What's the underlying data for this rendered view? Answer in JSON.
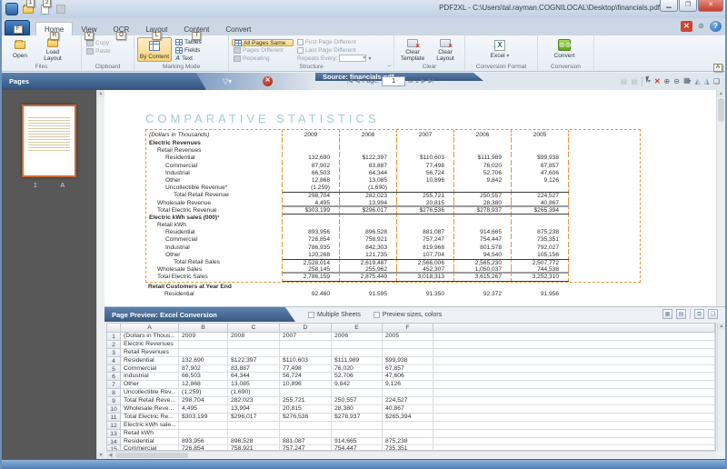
{
  "titlebar": {
    "title": "PDF2XL - C:\\Users\\tal.rayman.COGNILOCAL\\Desktop\\financials.pdf"
  },
  "qat": {
    "keytip_open": "1",
    "keytip_load": "2"
  },
  "file_button": {
    "keytip": "F"
  },
  "tabs": [
    {
      "label": "Home",
      "keytip": "H"
    },
    {
      "label": "View",
      "keytip": "V"
    },
    {
      "label": "OCR",
      "keytip": "O"
    },
    {
      "label": "Layout",
      "keytip": "L"
    },
    {
      "label": "Content",
      "keytip": "T"
    },
    {
      "label": "Convert",
      "keytip": ""
    }
  ],
  "ribbon": {
    "keytip_right": "A",
    "files": {
      "open": "Open",
      "load_layout": "Load Layout",
      "group": "Files"
    },
    "clipboard": {
      "copy": "Copy",
      "paste": "Paste",
      "group": "Clipboard"
    },
    "marking_mode": {
      "by_content": "By Content",
      "tables": "Tables",
      "fields": "Fields",
      "text": "Text",
      "group": "Marking Mode"
    },
    "structure": {
      "all_pages_same": "All Pages Same",
      "pages_different": "Pages Different",
      "repeating": "Repeating",
      "first_page_different": "First Page Different",
      "last_page_different": "Last Page Different",
      "repeats_every": "Repeats Every:",
      "group": "Structure"
    },
    "clear": {
      "clear_template": "Clear Template",
      "clear_layout": "Clear Layout",
      "group": "Clear"
    },
    "conversion_format": {
      "excel": "Excel",
      "group": "Conversion Format"
    },
    "conversion": {
      "convert": "Convert",
      "group": "Conversion"
    }
  },
  "doc_toolbar": {
    "page_label": "Page:",
    "page_value": "1",
    "of_label": "of 1"
  },
  "pages_panel": {
    "title": "Pages",
    "thumb_number": "1",
    "thumb_letter": "A"
  },
  "source_tab": {
    "label": "Source: financials.pdf"
  },
  "document": {
    "title": "COMPARATIVE STATISTICS",
    "table": {
      "caption": "(Dollars in Thousands)",
      "years": [
        "2009",
        "2008",
        "2007",
        "2006",
        "2005"
      ],
      "rows": [
        {
          "label": "Electric Revenues",
          "indent": 0,
          "bold": true,
          "values": [
            "",
            "",
            "",
            "",
            ""
          ]
        },
        {
          "label": "Retail Revenues",
          "indent": 1,
          "values": [
            "",
            "",
            "",
            "",
            ""
          ]
        },
        {
          "label": "Residential",
          "indent": 2,
          "values": [
            "132,690",
            "$122,397",
            "$110,603",
            "$111,989",
            "$99,938"
          ]
        },
        {
          "label": "Commercial",
          "indent": 2,
          "values": [
            "87,902",
            "83,887",
            "77,498",
            "76,020",
            "67,857"
          ]
        },
        {
          "label": "Industrial",
          "indent": 2,
          "values": [
            "66,503",
            "64,344",
            "56,724",
            "52,706",
            "47,606"
          ]
        },
        {
          "label": "Other",
          "indent": 2,
          "values": [
            "12,868",
            "13,085",
            "10,896",
            "9,842",
            "9,126"
          ]
        },
        {
          "label": "Uncollectible Revenue*",
          "indent": 2,
          "values": [
            "(1,259)",
            "(1,690)",
            "",
            "",
            ""
          ]
        },
        {
          "label": "Total Retail Revenue",
          "indent": 3,
          "values": [
            "298,704",
            "282,023",
            "255,721",
            "250,557",
            "224,527"
          ],
          "rule": "top"
        },
        {
          "label": "Wholesale Revenue",
          "indent": 1,
          "values": [
            "4,495",
            "13,994",
            "20,815",
            "28,380",
            "40,867"
          ],
          "rule": "thick"
        },
        {
          "label": "Total Electric Revenue",
          "indent": 1,
          "values": [
            "$303,199",
            "$296,017",
            "$276,536",
            "$278,937",
            "$265,394"
          ],
          "rule": "bottom"
        },
        {
          "label": "Electric kWh sales (000)¹",
          "indent": 0,
          "bold": true,
          "values": [
            "",
            "",
            "",
            "",
            ""
          ]
        },
        {
          "label": "Retail kWh",
          "indent": 1,
          "values": [
            "",
            "",
            "",
            "",
            ""
          ]
        },
        {
          "label": "Residential",
          "indent": 2,
          "values": [
            "893,956",
            "896,528",
            "881,087",
            "914,665",
            "875,238"
          ]
        },
        {
          "label": "Commercial",
          "indent": 2,
          "values": [
            "726,854",
            "758,921",
            "757,247",
            "754,447",
            "735,351"
          ]
        },
        {
          "label": "Industrial",
          "indent": 2,
          "values": [
            "786,935",
            "842,303",
            "819,968",
            "801,578",
            "792,027"
          ]
        },
        {
          "label": "Other",
          "indent": 2,
          "values": [
            "120,268",
            "121,735",
            "107,704",
            "94,540",
            "105,156"
          ]
        },
        {
          "label": "Total Retail Sales",
          "indent": 3,
          "values": [
            "2,528,014",
            "2,619,487",
            "2,566,006",
            "2,565,230",
            "2,507,772"
          ],
          "rule": "top"
        },
        {
          "label": "Wholesale Sales",
          "indent": 1,
          "values": [
            "258,145",
            "255,962",
            "452,307",
            "1,050,037",
            "744,538"
          ],
          "rule": "thick"
        },
        {
          "label": "Total Electric Sales",
          "indent": 1,
          "values": [
            "2,786,159",
            "2,875,449",
            "3,018,313",
            "3,615,267",
            "3,252,310"
          ],
          "rule": "bottom"
        }
      ],
      "outside_rows": [
        {
          "label": "Retail Customers at Year End",
          "indent": 0,
          "bold": true,
          "values": [
            "",
            "",
            "",
            "",
            ""
          ]
        },
        {
          "label": "Residential",
          "indent": 2,
          "values": [
            "92,460",
            "91,595",
            "91,350",
            "92,372",
            "91,956"
          ],
          "clipped": true
        }
      ]
    }
  },
  "preview": {
    "tab": "Page Preview: Excel Conversion",
    "multiple_sheets": "Multiple Sheets",
    "preview_sizes": "Preview sizes, colors",
    "columns": [
      "A",
      "B",
      "C",
      "D",
      "E",
      "F"
    ],
    "rows": [
      {
        "n": "1",
        "cells": [
          "(Dollars in Thous...",
          "2009",
          "2008",
          "2007",
          "2006",
          "2005"
        ]
      },
      {
        "n": "2",
        "cells": [
          "Electric Revenues",
          "",
          "",
          "",
          "",
          ""
        ]
      },
      {
        "n": "3",
        "cells": [
          "Retail Revenues",
          "",
          "",
          "",
          "",
          ""
        ]
      },
      {
        "n": "4",
        "cells": [
          "Residential",
          "132,690",
          "$122,397",
          "$110,603",
          "$111,989",
          "$99,938"
        ]
      },
      {
        "n": "5",
        "cells": [
          "Commercial",
          "87,902",
          "83,887",
          "77,498",
          "76,020",
          "67,857"
        ]
      },
      {
        "n": "6",
        "cells": [
          "Industrial",
          "66,503",
          "64,344",
          "56,724",
          "52,706",
          "47,606"
        ]
      },
      {
        "n": "7",
        "cells": [
          "Other",
          "12,868",
          "13,085",
          "10,896",
          "9,842",
          "9,126"
        ]
      },
      {
        "n": "8",
        "cells": [
          "Uncollectible Rev...",
          "(1,259)",
          "(1,690)",
          "",
          "",
          ""
        ]
      },
      {
        "n": "9",
        "cells": [
          "Total Retail Reve...",
          "298,704",
          "282,023",
          "255,721",
          "250,557",
          "224,527"
        ]
      },
      {
        "n": "10",
        "cells": [
          "Wholesale Reve...",
          "4,495",
          "13,994",
          "20,815",
          "28,380",
          "40,867"
        ]
      },
      {
        "n": "11",
        "cells": [
          "Total Electric Re...",
          "$303,199",
          "$296,017",
          "$276,536",
          "$278,937",
          "$265,394"
        ]
      },
      {
        "n": "12",
        "cells": [
          "Electric kWh sale...",
          "",
          "",
          "",
          "",
          ""
        ]
      },
      {
        "n": "13",
        "cells": [
          "Retail kWh",
          "",
          "",
          "",
          "",
          ""
        ]
      },
      {
        "n": "14",
        "cells": [
          "Residential",
          "893,956",
          "896,528",
          "881,087",
          "914,665",
          "875,238"
        ]
      },
      {
        "n": "15",
        "cells": [
          "Commercial",
          "726,854",
          "758,921",
          "757,247",
          "754,447",
          "735,351"
        ]
      }
    ]
  },
  "colors": {
    "accent_orange": "#f9d477",
    "marking_dash": "#e09a37",
    "panel_blue": "#4a6f9e",
    "doc_title_teal": "#a5ccd3"
  }
}
